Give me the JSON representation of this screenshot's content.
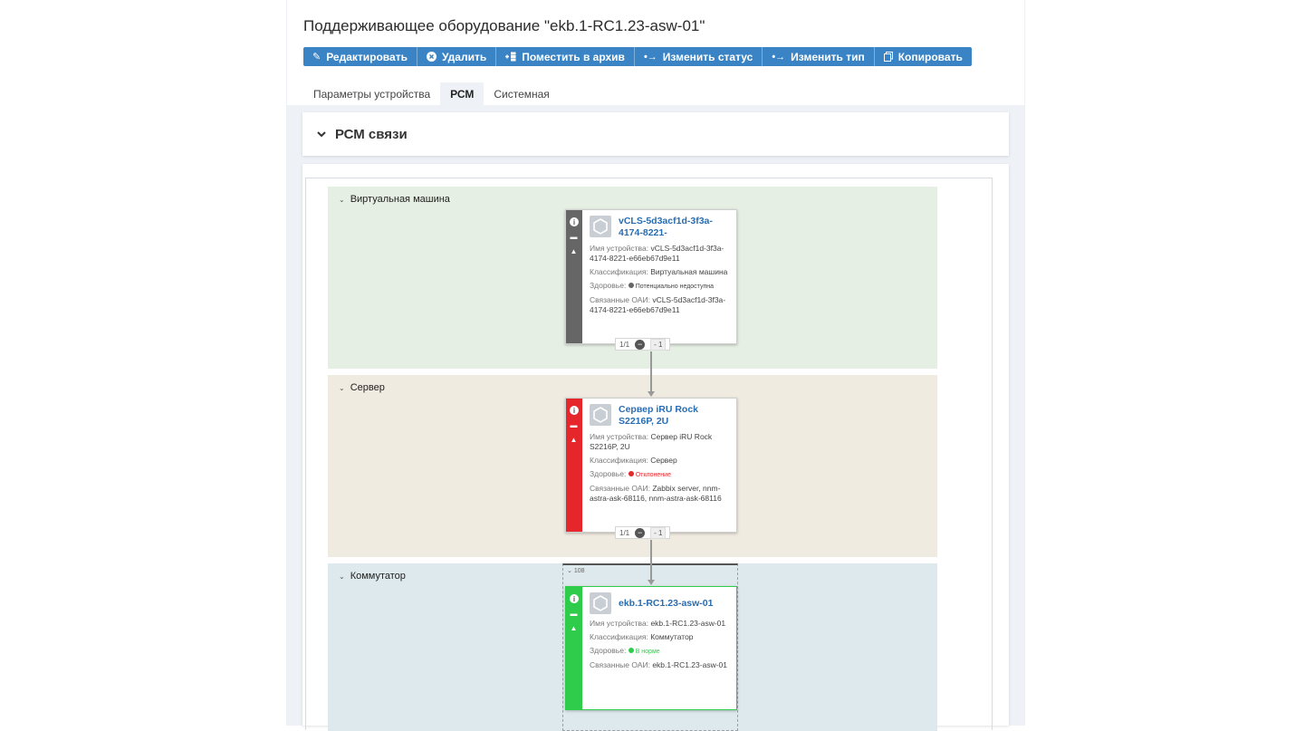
{
  "page": {
    "title": "Поддерживающее оборудование \"ekb.1-RC1.23-asw-01\""
  },
  "toolbar": {
    "edit": "Редактировать",
    "delete": "Удалить",
    "archive": "Поместить в архив",
    "change_status": "Изменить статус",
    "change_type": "Изменить тип",
    "copy": "Копировать"
  },
  "tabs": [
    {
      "label": "Параметры устройства",
      "active": false
    },
    {
      "label": "РСМ",
      "active": true
    },
    {
      "label": "Системная",
      "active": false
    }
  ],
  "section": {
    "title": "РСМ связи"
  },
  "colors": {
    "accent": "#3a84c5",
    "vm_lane": "#e6efe3",
    "server_lane": "#f0ebe0",
    "switch_lane": "#dde9ec",
    "status_unknown": "#666666",
    "status_deviation": "#e5262b",
    "status_ok": "#2ecc4a"
  },
  "labels": {
    "device_name": "Имя устройства:",
    "classification": "Классификация:",
    "health": "Здоровье:",
    "linked": "Связанные ОАИ:"
  },
  "lanes": [
    {
      "label": "Виртуальная машина"
    },
    {
      "label": "Сервер"
    },
    {
      "label": "Коммутатор"
    }
  ],
  "nodes": [
    {
      "title": "vCLS-5d3acf1d-3f3a-4174-8221-",
      "device_name": "vCLS-5d3acf1d-3f3a-4174-8221-e66eb67d9e11",
      "classification": "Виртуальная машина",
      "health": "Потенциально недоступна",
      "linked": "vCLS-5d3acf1d-3f3a-4174-8221-e66eb67d9e11",
      "pager": "1/1",
      "delta": "- 1"
    },
    {
      "title": "Сервер iRU Rock S2216P, 2U",
      "device_name": "Сервер iRU Rock S2216P, 2U",
      "classification": "Сервер",
      "health": "Отклонение",
      "linked": "Zabbix server, nnm-astra-ask-68116, nnm-astra-ask-68116",
      "pager": "1/1",
      "delta": "- 1"
    },
    {
      "title": "ekb.1-RC1.23-asw-01",
      "device_name": "ekb.1-RC1.23-asw-01",
      "classification": "Коммутатор",
      "health": "В норме",
      "linked": "ekb.1-RC1.23-asw-01",
      "count": "108"
    }
  ]
}
